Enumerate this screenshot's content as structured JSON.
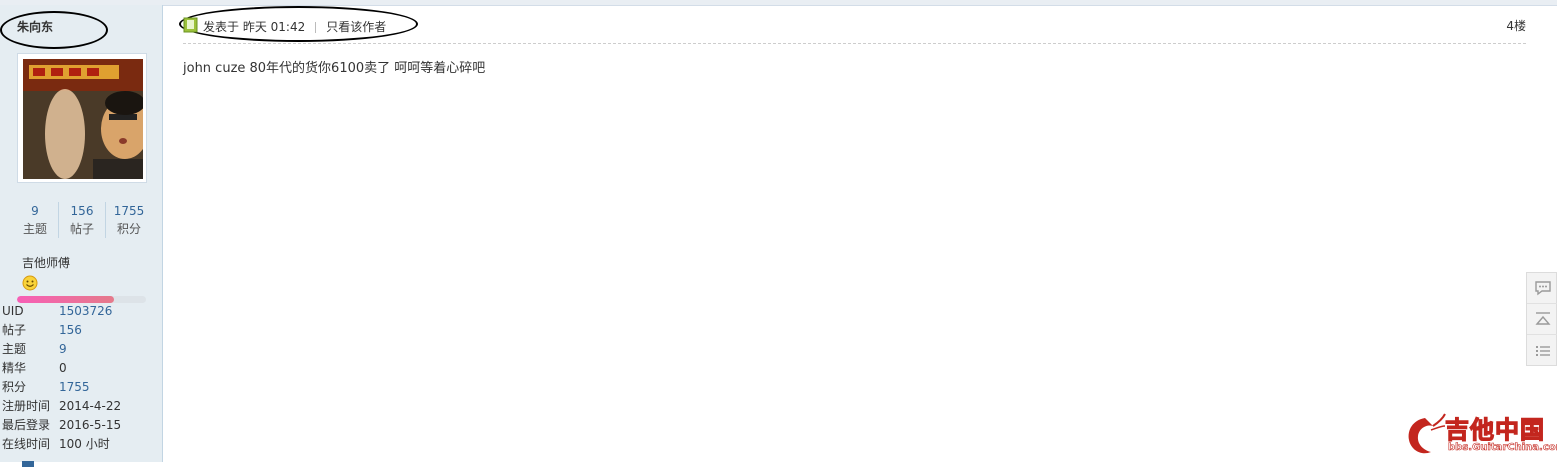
{
  "user": {
    "name": "朱向东",
    "stats": [
      {
        "value": "9",
        "label": "主题"
      },
      {
        "value": "156",
        "label": "帖子"
      },
      {
        "value": "1755",
        "label": "积分"
      }
    ],
    "rank": "吉他师傅",
    "rank_progress": 0.75,
    "info": [
      {
        "key": "UID",
        "value": "1503726"
      },
      {
        "key": "帖子",
        "value": "156"
      },
      {
        "key": "主题",
        "value": "9"
      },
      {
        "key": "精华",
        "value": "0"
      },
      {
        "key": "积分",
        "value": "1755"
      },
      {
        "key": "注册时间",
        "value": "2014-4-22"
      },
      {
        "key": "最后登录",
        "value": "2016-5-15"
      },
      {
        "key": "在线时间",
        "value": "100 小时"
      }
    ]
  },
  "post": {
    "posted_label": "发表于 昨天 01:42",
    "only_author_label": "只看该作者",
    "floor": "4楼",
    "message": "john cuze 80年代的货你6100卖了 呵呵等着心碎吧"
  },
  "tools": [
    "reply-icon",
    "back-to-top-icon",
    "list-icon"
  ],
  "logo": {
    "text": "吉他中国",
    "url": "bbs.GuitarChina.com"
  },
  "colors": {
    "link": "#336699",
    "sidebar_bg": "#e5edf2",
    "progress": "#f75fb6",
    "logo_red": "#c3261e"
  }
}
